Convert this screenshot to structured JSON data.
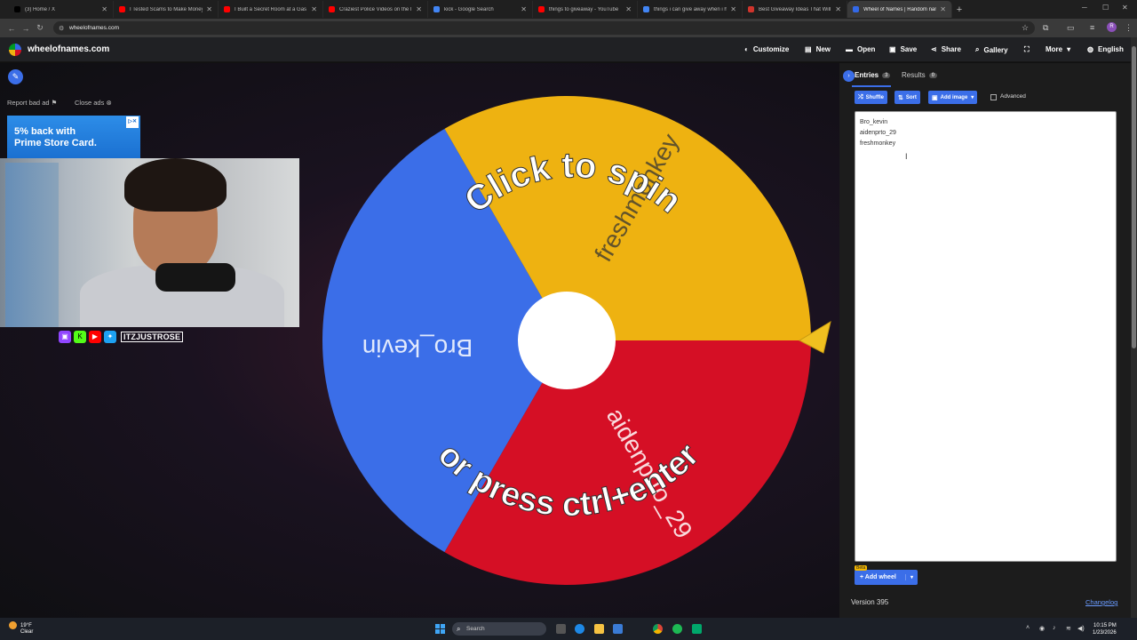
{
  "browser": {
    "tabs": [
      {
        "title": "(3) Home / X",
        "color": "#000000"
      },
      {
        "title": "I Tested Scams to Make Money",
        "color": "#ff0000"
      },
      {
        "title": "I Built a Secret Room at a Gas S",
        "color": "#ff0000"
      },
      {
        "title": "Craziest Police Videos on the In",
        "color": "#ff0000"
      },
      {
        "title": "kick - Google Search",
        "color": "#4285f4"
      },
      {
        "title": "things to giveaway - YouTube",
        "color": "#ff0000"
      },
      {
        "title": "things i can give away when i h",
        "color": "#4285f4"
      },
      {
        "title": "Best Giveaway Ideas That Will B",
        "color": "#d0342c"
      },
      {
        "title": "Wheel of Names | Random nam",
        "color": "#3369e8",
        "active": true
      }
    ],
    "new_tab": "+",
    "url": "wheelofnames.com",
    "profile_initial": "R"
  },
  "app": {
    "brand": "wheelofnames.com",
    "menu": [
      {
        "label": "Customize",
        "icon": "palette-icon"
      },
      {
        "label": "New",
        "icon": "file-icon"
      },
      {
        "label": "Open",
        "icon": "folder-icon"
      },
      {
        "label": "Save",
        "icon": "save-icon"
      },
      {
        "label": "Share",
        "icon": "share-icon"
      },
      {
        "label": "Gallery",
        "icon": "search-icon"
      },
      {
        "label": "",
        "icon": "fullscreen-icon"
      },
      {
        "label": "More",
        "icon": "chevron-down-icon"
      },
      {
        "label": "English",
        "icon": "globe-icon"
      }
    ]
  },
  "ads": {
    "report": "Report bad ad",
    "close": "Close ads",
    "banner_line1": "5% back with",
    "banner_line2": "Prime Store Card."
  },
  "stream": {
    "handle": "ITZJUSTROSE"
  },
  "wheel": {
    "click_text": "Click to spin",
    "press_text": "or press ctrl+enter",
    "segments": [
      {
        "name": "Bro_kevin",
        "color": "#3b6ee8"
      },
      {
        "name": "aidenprto_29",
        "color": "#d50f25"
      },
      {
        "name": "freshmonkey",
        "color": "#eeb211"
      }
    ]
  },
  "panel": {
    "tabs": [
      {
        "label": "Entries",
        "count": "3"
      },
      {
        "label": "Results",
        "count": "0"
      }
    ],
    "buttons": {
      "shuffle": "Shuffle",
      "sort": "Sort",
      "add_image": "Add image",
      "advanced": "Advanced"
    },
    "entries": [
      "Bro_kevin",
      "aidenprto_29",
      "freshmonkey"
    ],
    "beta": "Beta",
    "add_wheel": "Add wheel",
    "version": "Version 395",
    "changelog": "Changelog"
  },
  "taskbar": {
    "weather_temp": "19°F",
    "weather_desc": "Clear",
    "search": "Search",
    "time": "10:15 PM",
    "date": "1/23/2026"
  }
}
